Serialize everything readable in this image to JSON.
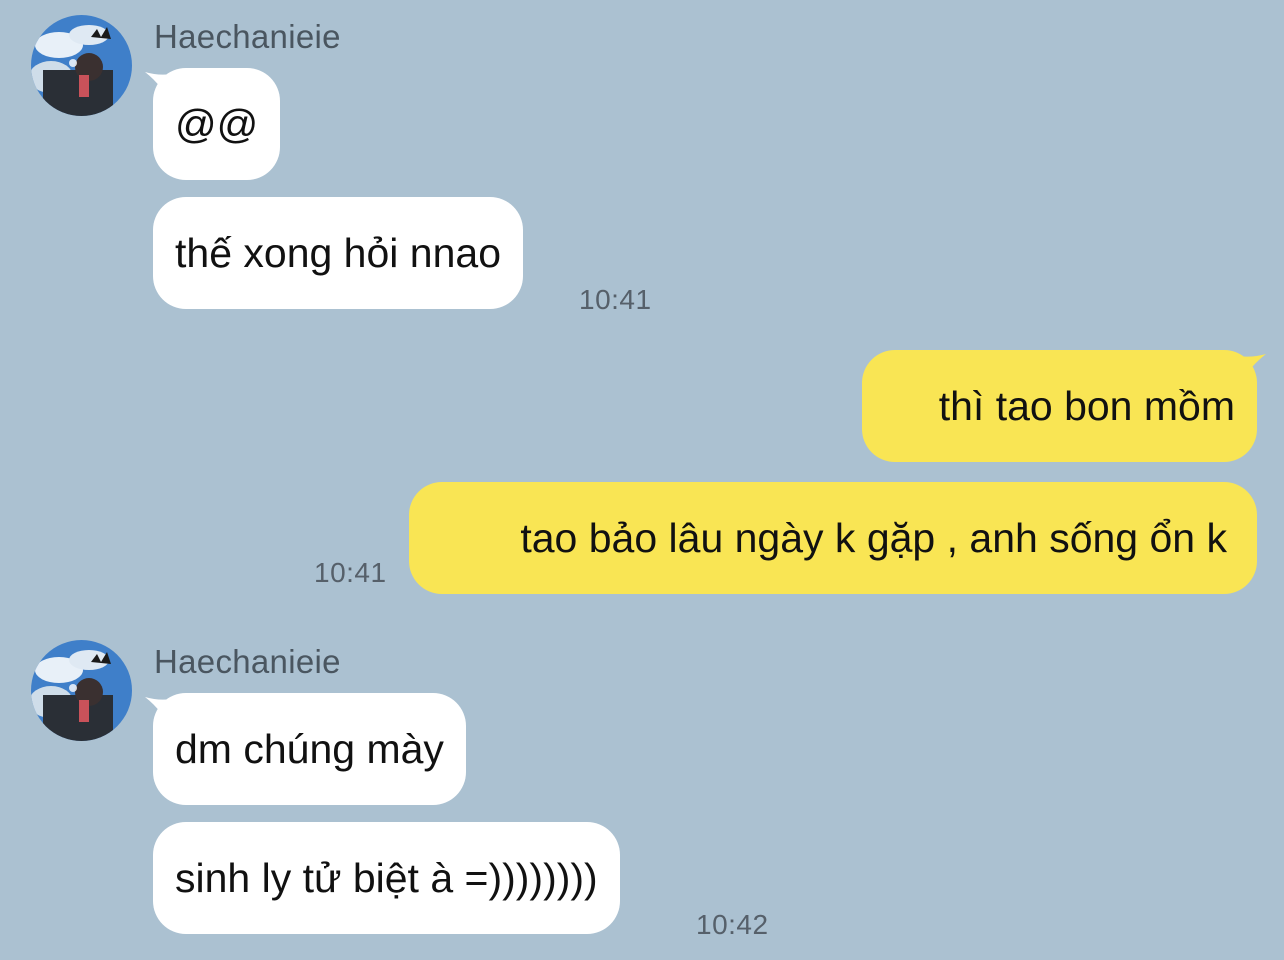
{
  "chat": {
    "groups": [
      {
        "sender": "Haechanieie",
        "messages": [
          {
            "text": "@@"
          },
          {
            "text": "thế xong hỏi nnao",
            "time": "10:41"
          }
        ]
      },
      {
        "sender": "me",
        "messages": [
          {
            "text": "thì tao bon mồm"
          },
          {
            "text": "tao bảo lâu ngày k gặp , anh sống ổn k",
            "time": "10:41"
          }
        ]
      },
      {
        "sender": "Haechanieie",
        "messages": [
          {
            "text": "dm chúng mày"
          },
          {
            "text": "sinh ly tử biệt à =))))))))",
            "time": "10:42"
          }
        ]
      }
    ]
  },
  "colors": {
    "background": "#abc1d1",
    "incoming_bubble": "#ffffff",
    "outgoing_bubble": "#f9e554",
    "timestamp": "#56606a"
  }
}
